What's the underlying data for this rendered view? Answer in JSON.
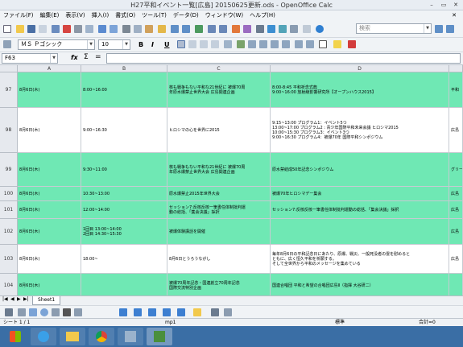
{
  "window": {
    "title": "H27平和イベント一覧[広島] 20150625更新.ods - OpenOffice Calc"
  },
  "menu": [
    "ファイル(F)",
    "編集(E)",
    "表示(V)",
    "挿入(I)",
    "書式(O)",
    "ツール(T)",
    "データ(D)",
    "ウィンドウ(W)",
    "ヘルプ(H)"
  ],
  "toolbar": {
    "search_placeholder": "検索"
  },
  "format": {
    "font_name": "ＭＳ Ｐゴシック",
    "font_size": "10",
    "bold": "B",
    "italic": "I",
    "underline": "U"
  },
  "formula_bar": {
    "cell_ref": "F63",
    "value": ""
  },
  "columns": [
    "A",
    "B",
    "C",
    "D"
  ],
  "rows": [
    {
      "num": "97",
      "color": "#6fe8b4",
      "a": "8月6日(木)",
      "b": "8:00~16:00",
      "c": "核も戦争もない平和な21世紀に 被爆70周\n年原水爆禁止世界大会 広島関連企画",
      "d": "8:00-8:45 平和祈念式典\n9:00~16:00 放射線影響研究所【オープンハウス2015】",
      "e": "平和"
    },
    {
      "num": "98",
      "color": "#ffffff",
      "a": "8月6日(木)",
      "b": "9:00~16:30",
      "c": "ヒロシマの心を世界に2015",
      "d": "9:15~13:00 プログラム1：イベント5つ\n13:00~17:00 プログラム2 : 青少年国際平和未来会議 ヒロシマ2015\n10:00~15:30 プログラム3：イベント3つ\n9:00~16:30 プログラム4：被爆70年 国際平和シンポジウム",
      "e": "広島"
    },
    {
      "num": "99",
      "color": "#6fe8b4",
      "a": "8月6日(木)",
      "b": "9:30~11:00",
      "c": "核も戦争もない平和な21世紀に 被爆70周\n年原水爆禁止世界大会 広島関連企画",
      "d": "原水禁結成50年記念シンポジウム",
      "e": "グリー"
    },
    {
      "num": "100",
      "color": "#6fe8b4",
      "a": "8月6日(木)",
      "b": "10:30~13:00",
      "c": "原水爆禁止2015年世界大会",
      "d": "被爆70年ヒロシマデー集会",
      "e": "広島"
    },
    {
      "num": "101",
      "color": "#6fe8b4",
      "a": "8月6日(木)",
      "b": "12:00~14:00",
      "c": "セッション7:反核反核一筆書任体制批判運\n動の総括、「集会決議」採択",
      "d": "セッション7:反核反核一筆書任体制批判運動の総括、「集会決議」採択",
      "e": "広島"
    },
    {
      "num": "102",
      "color": "#6fe8b4",
      "a": "8月6日(木)",
      "b": "1回目 13:00~14:00\n2回目 14:30~15:30",
      "c": "被爆体験講話を開催",
      "d": "",
      "e": "広島"
    },
    {
      "num": "103",
      "color": "#ffffff",
      "a": "8月6日(木)",
      "b": "18:00~",
      "c": "8月6日とうろうながし",
      "d": "毎年8月6日の平和記念日にあたり、原爆、戦災、一般死没者の霊を慰めると\nともに、広く恒久平和を祈願する。\nそして全世界から平和のメッセージを集めている",
      "e": "広島"
    },
    {
      "num": "104",
      "color": "#6fe8b4",
      "a": "8月6日(木)",
      "b": "",
      "c": "被爆70周年記念・国連創立70周年記念\n国際交流特別企画",
      "d": "国連合唱団 平和と希望の合唱団広島Ⅱ（指揮 大谷研二）",
      "e": ""
    }
  ],
  "sheet_tab": "Sheet1",
  "status": {
    "sheet": "シート 1 / 1",
    "style": "mp1",
    "mode": "標準",
    "sum": "合計=0"
  }
}
